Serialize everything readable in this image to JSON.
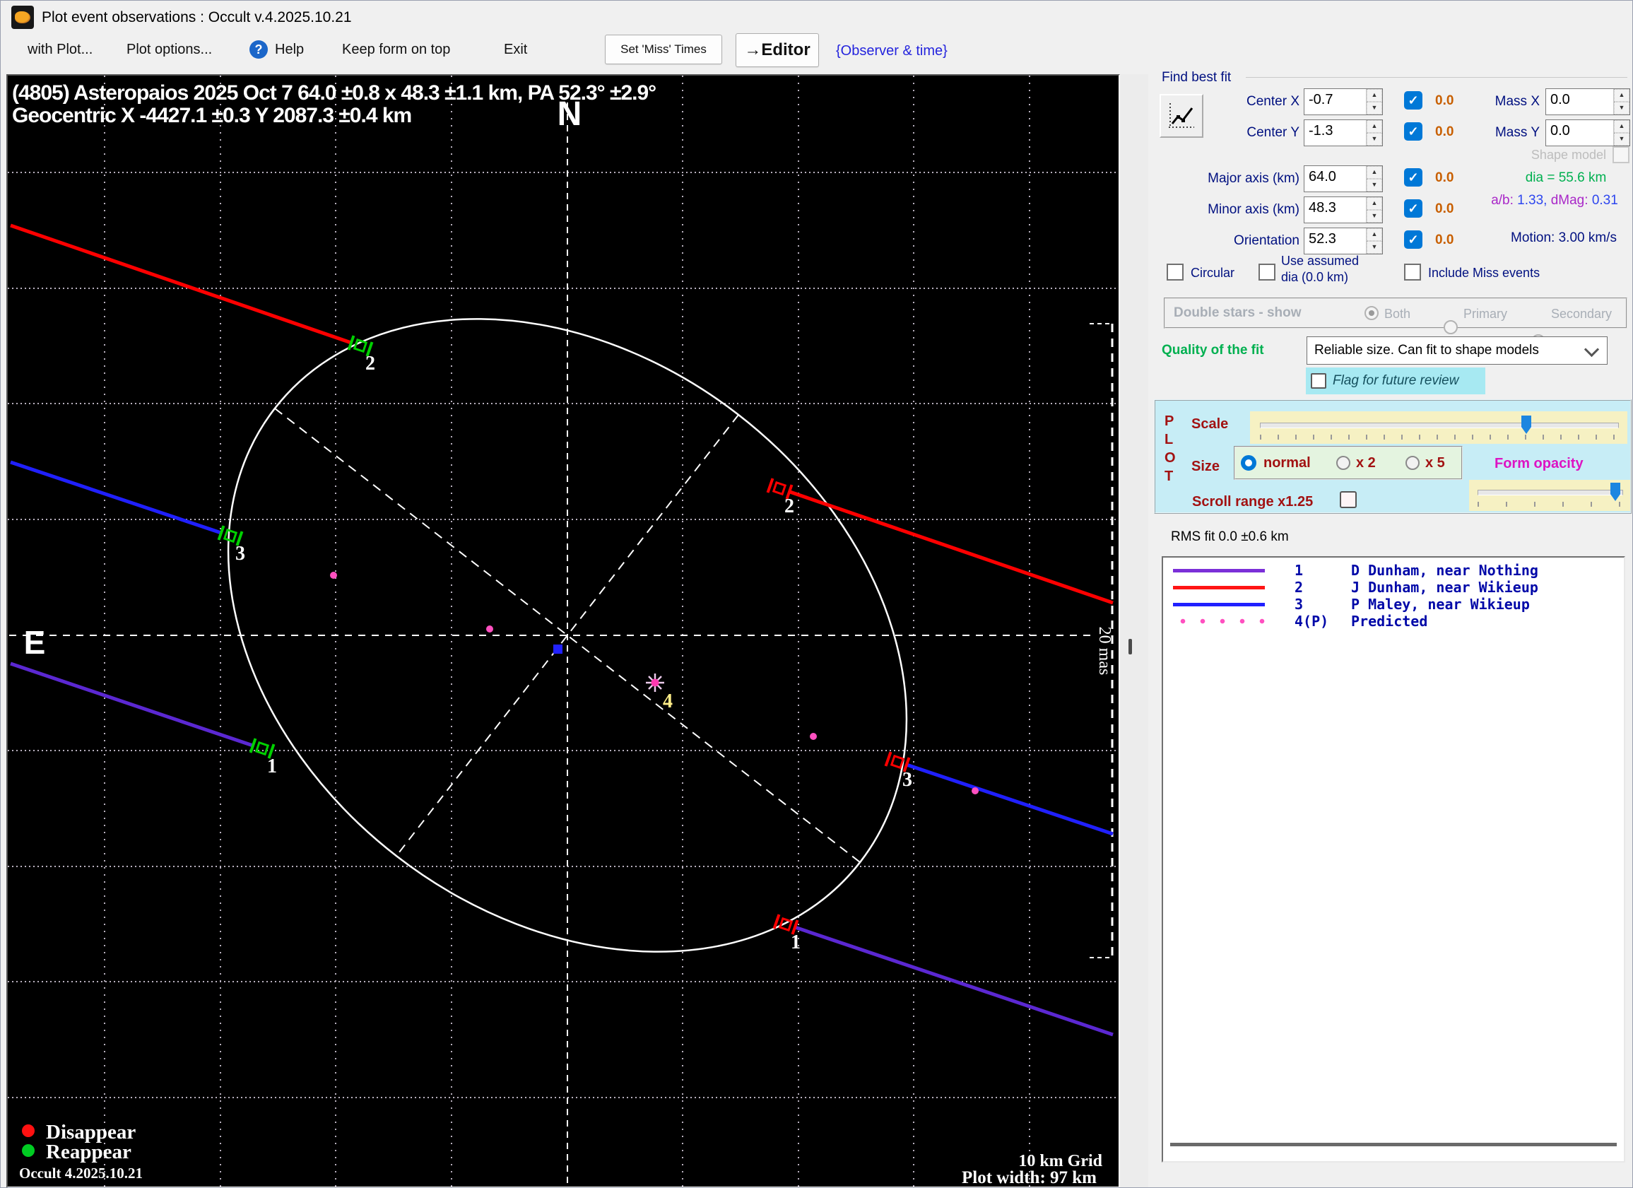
{
  "window": {
    "title": "Plot event observations : Occult v.4.2025.10.21"
  },
  "menu": {
    "with_plot": "with Plot...",
    "plot_options": "Plot options...",
    "help": "Help",
    "keep_on_top": "Keep form on top",
    "exit": "Exit"
  },
  "toolbar": {
    "set_miss_times": "Set 'Miss' Times",
    "editor": "→Editor",
    "observer_time": "{Observer & time}"
  },
  "plot": {
    "title_line1": "(4805) Asteropaios  2025 Oct 7   64.0 ±0.8 x 48.3 ±1.1 km, PA 52.3° ±2.9°",
    "title_line2": "Geocentric  X  -4427.1 ±0.3  Y 2087.3 ±0.4 km",
    "north": "N",
    "east": "E",
    "scale_bar": "20 mas",
    "markers": {
      "r2": "2",
      "d2": "2",
      "r3": "3",
      "d3": "3",
      "r1": "1",
      "d1": "1",
      "p4": "4"
    },
    "legend": {
      "disappear": "Disappear",
      "reappear": "Reappear"
    },
    "version": "Occult 4.2025.10.21",
    "grid_label": "10 km Grid",
    "width_label": "Plot width: 97 km"
  },
  "fit": {
    "group_title": "Find best fit",
    "center_x": {
      "label": "Center X",
      "value": "-0.7",
      "sigma": "0.0"
    },
    "center_y": {
      "label": "Center Y",
      "value": "-1.3",
      "sigma": "0.0"
    },
    "major": {
      "label": "Major axis (km)",
      "value": "64.0",
      "sigma": "0.0"
    },
    "minor": {
      "label": "Minor axis (km)",
      "value": "48.3",
      "sigma": "0.0"
    },
    "orientation": {
      "label": "Orientation",
      "value": "52.3",
      "sigma": "0.0"
    },
    "mass_x": {
      "label": "Mass X",
      "value": "0.0"
    },
    "mass_y": {
      "label": "Mass Y",
      "value": "0.0"
    },
    "shape_model": "Shape model",
    "dia": "dia = 55.6 km",
    "ab_label": "a/b:",
    "ab_value": "1.33,",
    "dmag_label": "dMag:",
    "dmag_value": "0.31",
    "motion": "Motion: 3.00 km/s",
    "circular": "Circular",
    "use_assumed_1": "Use assumed",
    "use_assumed_2": "dia (0.0 km)",
    "include_miss": "Include Miss events",
    "double_stars": {
      "label": "Double stars - show",
      "both": "Both",
      "primary": "Primary",
      "secondary": "Secondary"
    },
    "quality_label": "Quality of the fit",
    "quality_value": "Reliable size. Can fit to shape models",
    "flag": "Flag for future review"
  },
  "plot_controls": {
    "letters": [
      "P",
      "L",
      "O",
      "T"
    ],
    "scale": "Scale",
    "size": "Size",
    "normal": "normal",
    "x2": "x 2",
    "x5": "x 5",
    "form_opacity": "Form opacity",
    "scroll_range": "Scroll range x1.25"
  },
  "rms": "RMS fit 0.0 ±0.6 km",
  "observations": [
    {
      "num": "1",
      "name": "D Dunham, near Nothing",
      "color": "#7b2fd8"
    },
    {
      "num": "2",
      "name": "J Dunham, near Wikieup",
      "color": "#ff1515"
    },
    {
      "num": "3",
      "name": "P Maley, near Wikieup",
      "color": "#2020ff"
    },
    {
      "num": "4(P)",
      "name": "Predicted",
      "color": "#ff50c0"
    }
  ]
}
